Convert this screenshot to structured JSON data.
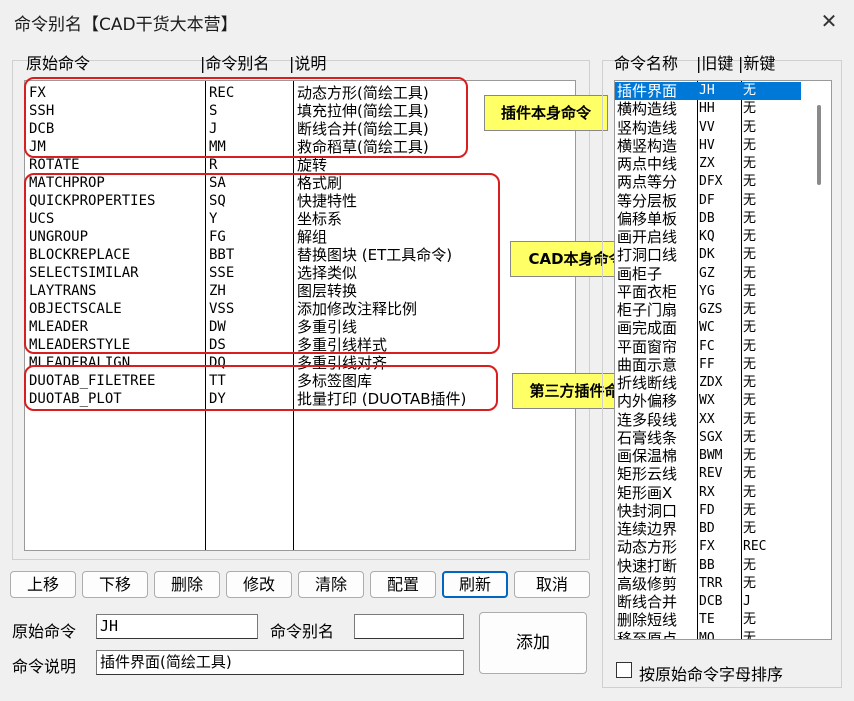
{
  "window": {
    "title": "命令别名【CAD干货大本营】",
    "close_glyph": "✕"
  },
  "left_headers": {
    "original": "原始命令",
    "alias": "|命令别名",
    "desc": "|说明"
  },
  "commands": [
    {
      "orig": "FX",
      "alias": "REC",
      "desc": "动态方形(简绘工具)"
    },
    {
      "orig": "SSH",
      "alias": "S",
      "desc": "填充拉伸(简绘工具)"
    },
    {
      "orig": "DCB",
      "alias": "J",
      "desc": "断线合并(简绘工具)"
    },
    {
      "orig": "JM",
      "alias": "MM",
      "desc": "救命稻草(简绘工具)"
    },
    {
      "orig": "ROTATE",
      "alias": "R",
      "desc": "旋转"
    },
    {
      "orig": "MATCHPROP",
      "alias": "SA",
      "desc": "格式刷"
    },
    {
      "orig": "QUICKPROPERTIES",
      "alias": "SQ",
      "desc": "快捷特性"
    },
    {
      "orig": "UCS",
      "alias": "Y",
      "desc": "坐标系"
    },
    {
      "orig": "UNGROUP",
      "alias": "FG",
      "desc": "解组"
    },
    {
      "orig": "BLOCKREPLACE",
      "alias": "BBT",
      "desc": "替换图块 (ET工具命令)"
    },
    {
      "orig": "SELECTSIMILAR",
      "alias": "SSE",
      "desc": "选择类似"
    },
    {
      "orig": "LAYTRANS",
      "alias": "ZH",
      "desc": "图层转换"
    },
    {
      "orig": "OBJECTSCALE",
      "alias": "VSS",
      "desc": "添加修改注释比例"
    },
    {
      "orig": "MLEADER",
      "alias": "DW",
      "desc": "多重引线"
    },
    {
      "orig": "MLEADERSTYLE",
      "alias": "DS",
      "desc": "多重引线样式"
    },
    {
      "orig": "MLEADERALIGN",
      "alias": "DQ",
      "desc": "多重引线对齐"
    },
    {
      "orig": "DUOTAB_FILETREE",
      "alias": "TT",
      "desc": "多标签图库"
    },
    {
      "orig": "DUOTAB_PLOT",
      "alias": "DY",
      "desc": "批量打印 (DUOTAB插件)"
    }
  ],
  "callouts": {
    "plugin": "插件本身命令",
    "cad": "CAD本身命令",
    "third": "第三方插件命令"
  },
  "buttons": {
    "up": "上移",
    "down": "下移",
    "delete": "删除",
    "modify": "修改",
    "clear": "清除",
    "config": "配置",
    "refresh": "刷新",
    "cancel": "取消",
    "add": "添加"
  },
  "form": {
    "orig_label": "原始命令",
    "orig_value": "JH",
    "alias_label": "命令别名",
    "alias_value": "",
    "desc_label": "命令说明",
    "desc_value": "插件界面(简绘工具)"
  },
  "right_headers": {
    "name": "命令名称",
    "old": "|旧键",
    "new": "|新键"
  },
  "right_list": [
    {
      "name": "插件界面",
      "old": "JH",
      "new": "无"
    },
    {
      "name": "横构造线",
      "old": "HH",
      "new": "无"
    },
    {
      "name": "竖构造线",
      "old": "VV",
      "new": "无"
    },
    {
      "name": "横竖构造",
      "old": "HV",
      "new": "无"
    },
    {
      "name": "两点中线",
      "old": "ZX",
      "new": "无"
    },
    {
      "name": "两点等分",
      "old": "DFX",
      "new": "无"
    },
    {
      "name": "等分层板",
      "old": "DF",
      "new": "无"
    },
    {
      "name": "偏移单板",
      "old": "DB",
      "new": "无"
    },
    {
      "name": "画开启线",
      "old": "KQ",
      "new": "无"
    },
    {
      "name": "打洞口线",
      "old": "DK",
      "new": "无"
    },
    {
      "name": "画柜子",
      "old": "GZ",
      "new": "无"
    },
    {
      "name": "平面衣柜",
      "old": "YG",
      "new": "无"
    },
    {
      "name": "柜子门扇",
      "old": "GZS",
      "new": "无"
    },
    {
      "name": "画完成面",
      "old": "WC",
      "new": "无"
    },
    {
      "name": "平面窗帘",
      "old": "FC",
      "new": "无"
    },
    {
      "name": "曲面示意",
      "old": "FF",
      "new": "无"
    },
    {
      "name": "折线断线",
      "old": "ZDX",
      "new": "无"
    },
    {
      "name": "内外偏移",
      "old": "WX",
      "new": "无"
    },
    {
      "name": "连多段线",
      "old": "XX",
      "new": "无"
    },
    {
      "name": "石膏线条",
      "old": "SGX",
      "new": "无"
    },
    {
      "name": "画保温棉",
      "old": "BWM",
      "new": "无"
    },
    {
      "name": "矩形云线",
      "old": "REV",
      "new": "无"
    },
    {
      "name": "矩形画X",
      "old": "RX",
      "new": "无"
    },
    {
      "name": "快封洞口",
      "old": "FD",
      "new": "无"
    },
    {
      "name": "连续边界",
      "old": "BD",
      "new": "无"
    },
    {
      "name": "动态方形",
      "old": "FX",
      "new": "REC"
    },
    {
      "name": "快速打断",
      "old": "BB",
      "new": "无"
    },
    {
      "name": "高级修剪",
      "old": "TRR",
      "new": "无"
    },
    {
      "name": "断线合并",
      "old": "DCB",
      "new": "J"
    },
    {
      "name": "删除短线",
      "old": "TE",
      "new": "无"
    },
    {
      "name": "移至原点",
      "old": "MO",
      "new": "无"
    }
  ],
  "sort_checkbox": {
    "label": "按原始命令字母排序",
    "checked": false
  }
}
